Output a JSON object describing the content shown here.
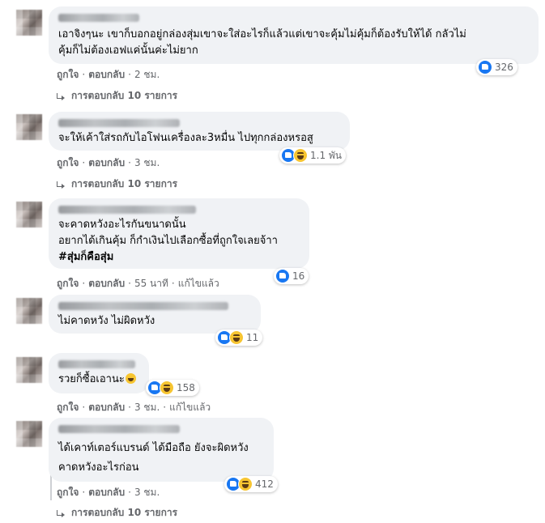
{
  "comments": [
    {
      "lines": [
        "เอาจิงๆนะ เขาก็บอกอยู่กล่องสุ่มเขาจะใส่อะไรก็แล้วแต่เขาจะคุ้มไม่คุ้มก็ต้องรับให้ได้ กลัวไม่",
        "คุ้มก็ไม่ต้องเอฟแค่นั้นค่ะไม่ยาก"
      ],
      "like": "ถูกใจ",
      "reply": "ตอบกลับ",
      "time": "2 ชม.",
      "edited": "",
      "reactions": [
        "like"
      ],
      "reaction_count": "326",
      "replies_label": "การตอบกลับ 10 รายการ"
    },
    {
      "lines": [
        "จะให้เค้าใส่รถกับไอโฟนเครื่องละ3หมื่น ไปทุกกล่องหรอสู"
      ],
      "like": "ถูกใจ",
      "reply": "ตอบกลับ",
      "time": "3 ชม.",
      "edited": "",
      "reactions": [
        "like",
        "haha"
      ],
      "reaction_count": "1.1 พัน",
      "replies_label": "การตอบกลับ 10 รายการ"
    },
    {
      "lines": [
        "จะคาดหวังอะไรกันขนาดนั้น",
        "อยากได้เกินคุ้ม ก็กำเงินไปเลือกซื้อที่ถูกใจเลยจ้าา"
      ],
      "hashtag": "#สุ่มก็คือสุ่ม",
      "like": "ถูกใจ",
      "reply": "ตอบกลับ",
      "time": "55 นาที",
      "edited": "แก้ไขแล้ว",
      "reactions": [
        "like"
      ],
      "reaction_count": "16"
    },
    {
      "lines": [
        "ไม่คาดหวัง ไม่ผิดหวัง"
      ],
      "like": "ถูกใจ",
      "reply": "ตอบกลับ",
      "time": "3 ชม.",
      "edited": "",
      "reactions": [
        "like",
        "haha"
      ],
      "reaction_count": "11"
    },
    {
      "lines": [
        "รวยก็ซื้อเอานะ"
      ],
      "like": "ถูกใจ",
      "reply": "ตอบกลับ",
      "time": "3 ชม.",
      "edited": "แก้ไขแล้ว",
      "reactions": [
        "like",
        "haha"
      ],
      "reaction_count": "158"
    },
    {
      "lines": [
        "ได้เคาท์เตอร์แบรนด์ ได้มือถือ ยังจะผิดหวัง",
        "คาดหวังอะไรก่อน"
      ],
      "like": "ถูกใจ",
      "reply": "ตอบกลับ",
      "time": "3 ชม.",
      "edited": "",
      "reactions": [
        "like",
        "haha"
      ],
      "reaction_count": "412",
      "replies_label": "การตอบกลับ 10 รายการ"
    }
  ],
  "colors": {
    "bubble": "#f0f2f5",
    "meta": "#65676b",
    "like_blue": "#1877f2",
    "haha_yellow": "#f7c531"
  }
}
